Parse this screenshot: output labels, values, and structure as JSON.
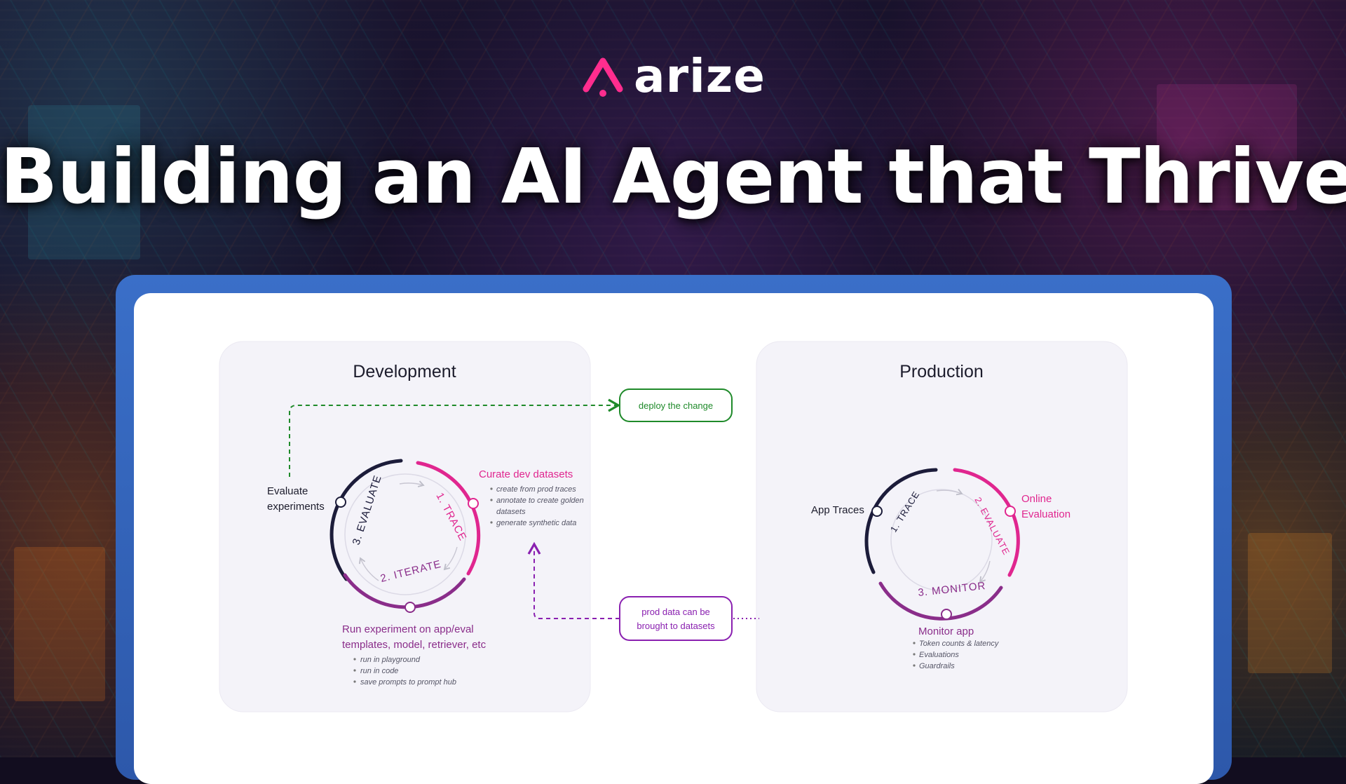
{
  "brand": {
    "name": "arize",
    "accent": "#ff2d8e"
  },
  "headline": "Building an AI Agent that Thrives",
  "colors": {
    "frame": "#3566c0",
    "pink": "#e0268f",
    "purple": "#8a2d8a",
    "navy": "#1c1c3a",
    "green": "#1f8a2a",
    "violet": "#8a20b0"
  },
  "development": {
    "title": "Development",
    "evaluate_experiments": [
      "Evaluate",
      "experiments"
    ],
    "steps": {
      "trace": "1. TRACE",
      "iterate": "2. ITERATE",
      "evaluate": "3. EVALUATE"
    },
    "curate": {
      "title": "Curate dev datasets",
      "bullets": [
        "create from prod  traces",
        "annotate to create golden",
        "datasets",
        "generate synthetic data"
      ]
    },
    "run": {
      "title": [
        "Run experiment on app/eval",
        "templates, model, retriever, etc"
      ],
      "bullets": [
        "run in playground",
        "run in code",
        "save prompts to prompt hub"
      ]
    }
  },
  "production": {
    "title": "Production",
    "app_traces": "App Traces",
    "online_evaluation": [
      "Online",
      "Evaluation"
    ],
    "steps": {
      "trace": "1. TRACE",
      "evaluate": "2. EVALUATE",
      "monitor": "3. MONITOR"
    },
    "monitor": {
      "title": "Monitor app",
      "bullets": [
        "Token counts & latency",
        "Evaluations",
        "Guardrails"
      ]
    }
  },
  "connectors": {
    "deploy": "deploy the change",
    "prod_data": [
      "prod data can be",
      "brought to datasets"
    ]
  }
}
